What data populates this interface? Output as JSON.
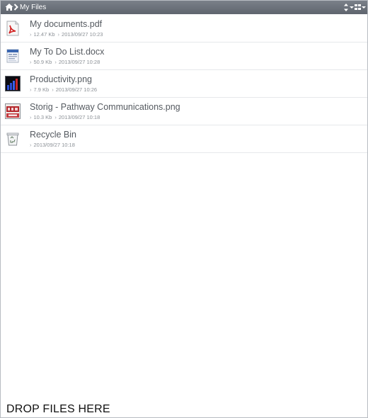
{
  "breadcrumb": {
    "home_icon": "home-icon",
    "separator_icon": "chevron-right-icon",
    "current": "My Files"
  },
  "toolbar": {
    "sort_icon": "sort-icon",
    "view_icon": "grid-view-icon"
  },
  "files": [
    {
      "name": "My documents.pdf",
      "size": "12.47 Kb",
      "date": "2013/09/27 10:23",
      "icon": "pdf-file-icon"
    },
    {
      "name": "My To Do List.docx",
      "size": "50.9 Kb",
      "date": "2013/09/27 10:28",
      "icon": "docx-file-icon"
    },
    {
      "name": "Productivity.png",
      "size": "7.9 Kb",
      "date": "2013/09/27 10:26",
      "icon": "png-chart-thumbnail-icon"
    },
    {
      "name": "Storig - Pathway Communications.png",
      "size": "10.3 Kb",
      "date": "2013/09/27 10:18",
      "icon": "png-storig-thumbnail-icon"
    },
    {
      "name": "Recycle Bin",
      "size": "",
      "date": "2013/09/27 10:18",
      "icon": "recycle-bin-icon"
    }
  ],
  "drop_zone": {
    "label": "DROP FILES HERE"
  }
}
